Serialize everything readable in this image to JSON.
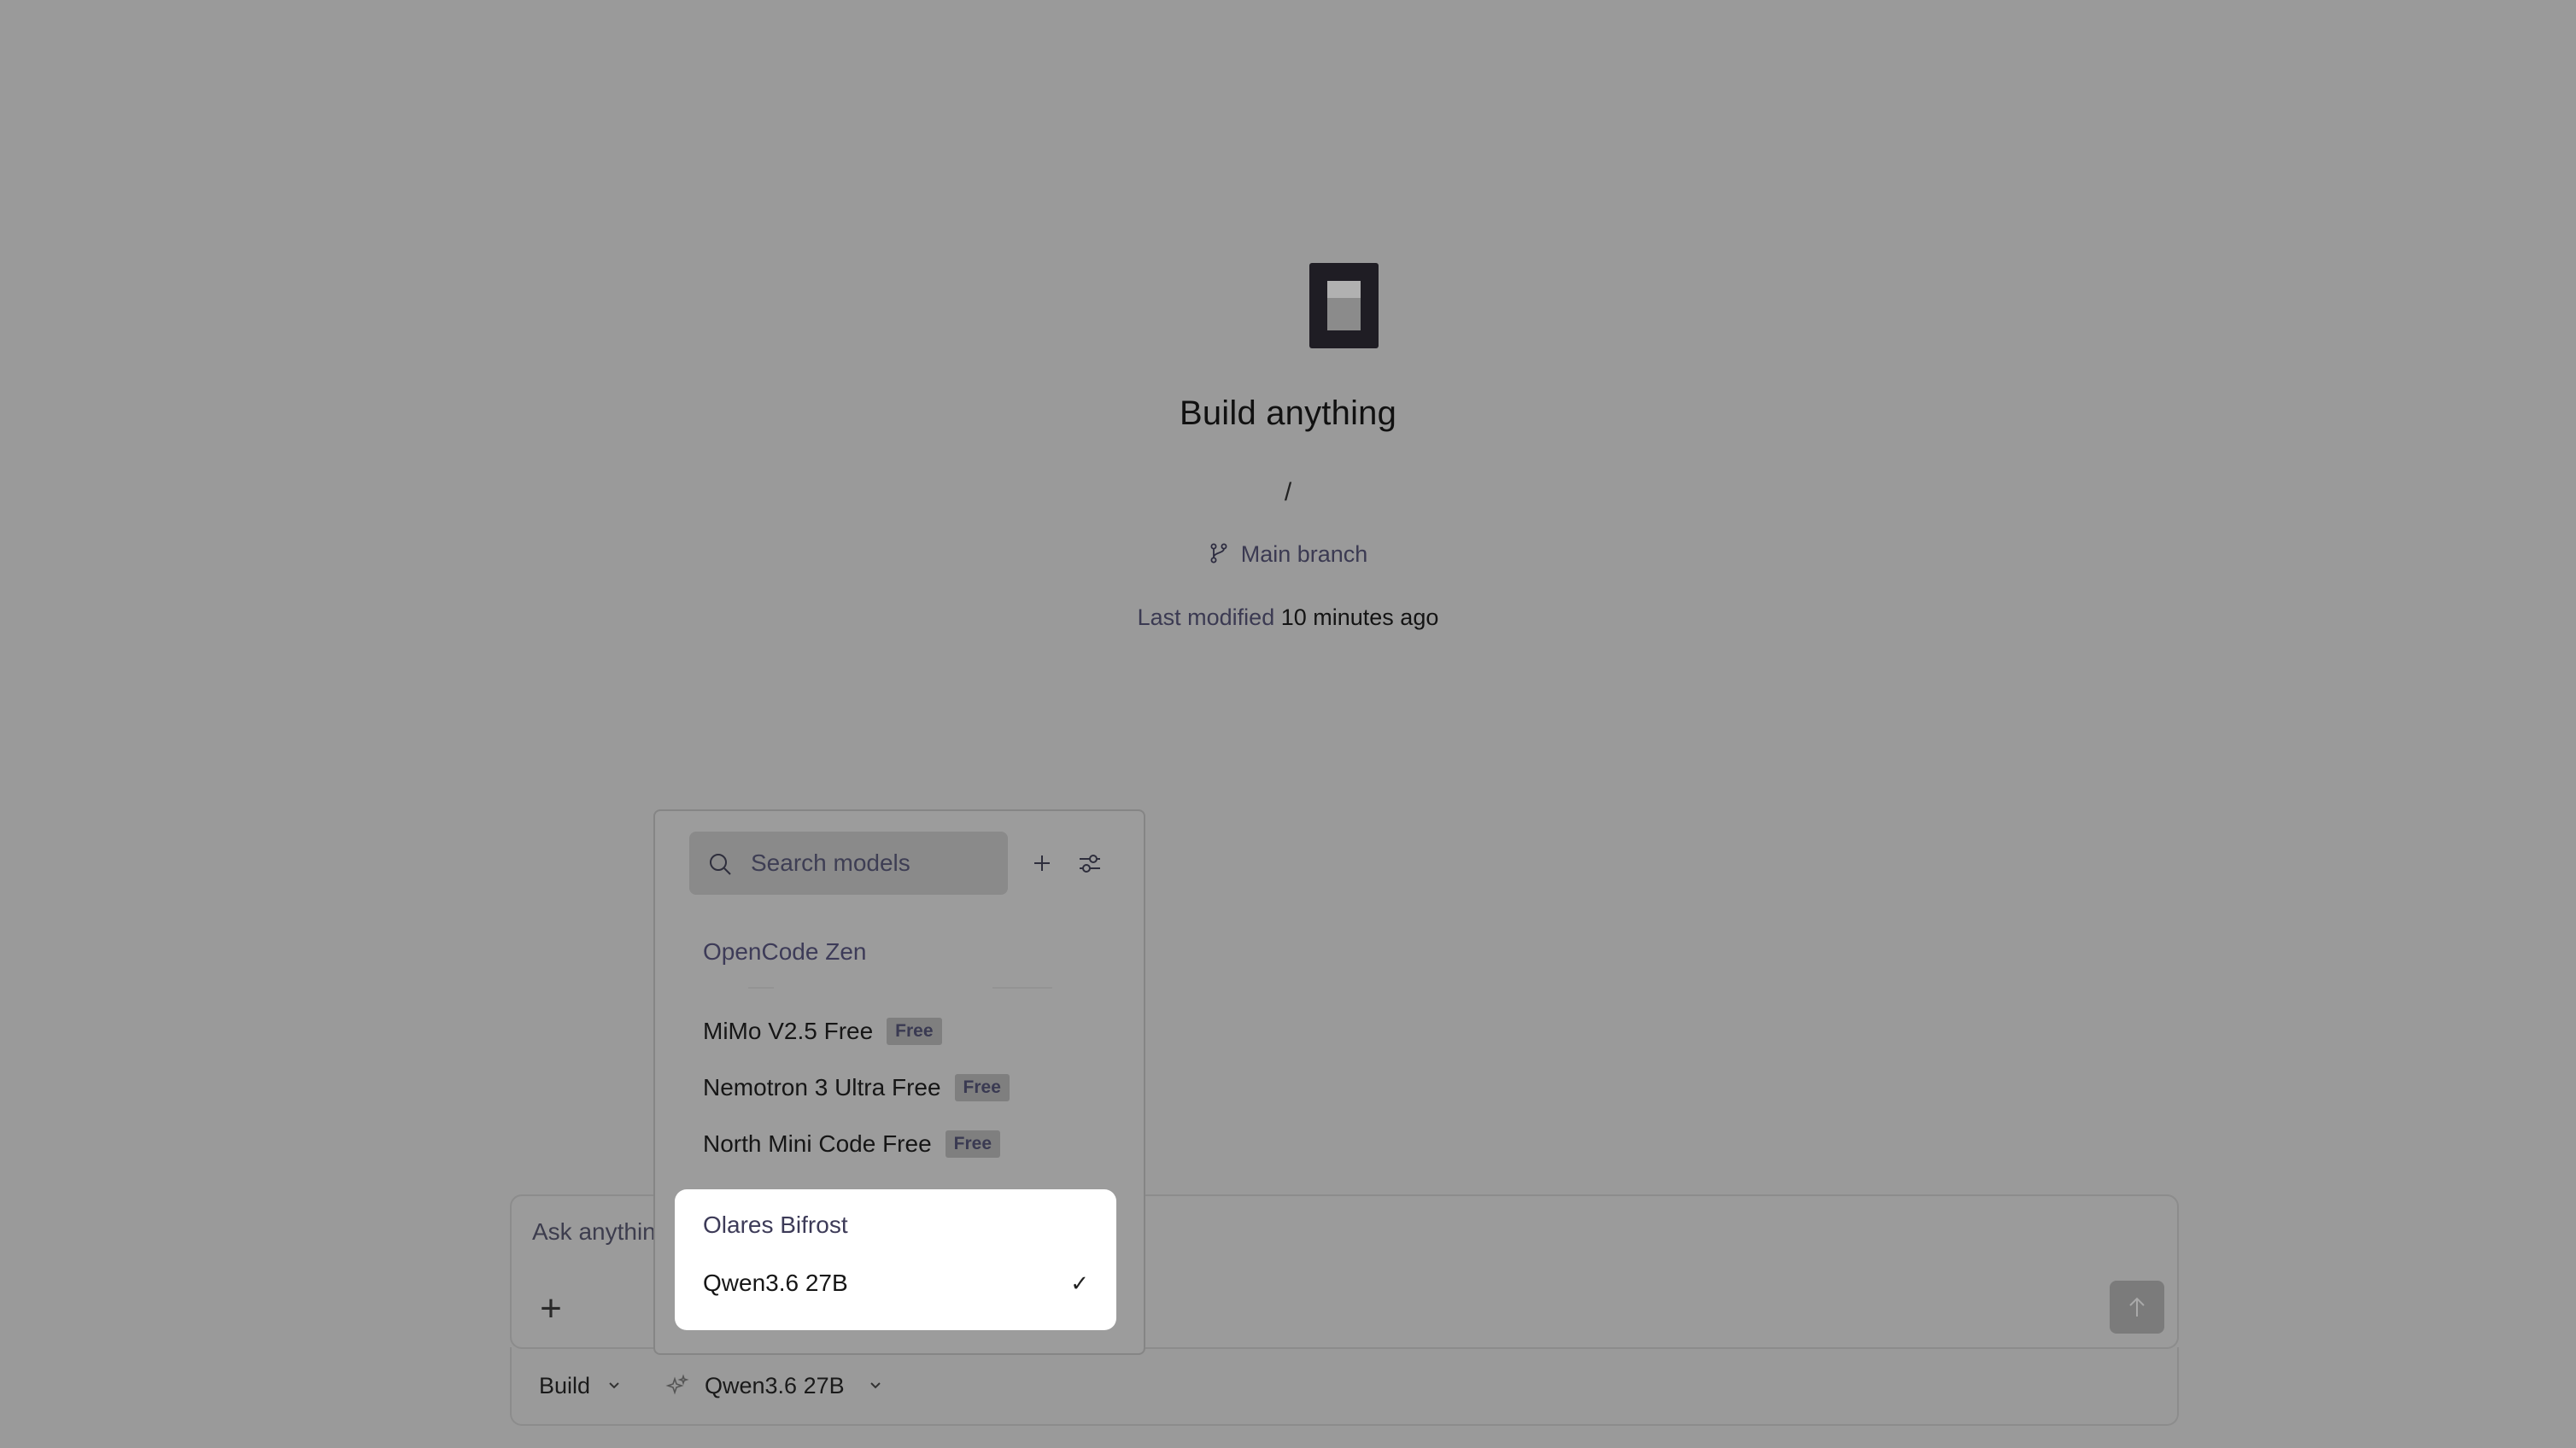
{
  "hero": {
    "title": "Build anything",
    "path": "/",
    "branch": "Main branch",
    "modified_label": "Last modified",
    "modified_value": "10 minutes ago"
  },
  "composer": {
    "placeholder": "Ask anythin"
  },
  "toolbar": {
    "mode": "Build",
    "model": "Qwen3.6 27B"
  },
  "model_picker": {
    "search_placeholder": "Search models",
    "groups": [
      {
        "label": "OpenCode Zen",
        "items": [
          {
            "name": "MiMo V2.5 Free",
            "badge": "Free"
          },
          {
            "name": "Nemotron 3 Ultra Free",
            "badge": "Free"
          },
          {
            "name": "North Mini Code Free",
            "badge": "Free"
          }
        ]
      },
      {
        "label": "Olares Bifrost",
        "items": [
          {
            "name": "Qwen3.6 27B",
            "selected": true,
            "check": "✓"
          }
        ]
      }
    ]
  },
  "colors": {
    "overlay_background": "#9a9a9a",
    "accent_text": "#3d3b58",
    "selected_card": "#ffffff"
  }
}
